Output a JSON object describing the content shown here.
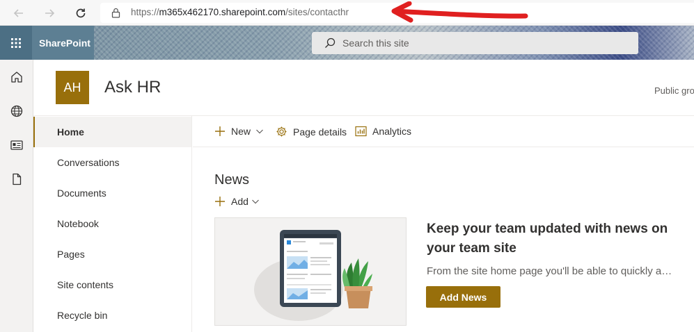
{
  "browser": {
    "url_prefix": "https://",
    "url_host": "m365x462170.sharepoint.com",
    "url_path": "/sites/contacthr"
  },
  "suite": {
    "app_name": "SharePoint",
    "search_placeholder": "Search this site"
  },
  "site": {
    "logo_initials": "AH",
    "title": "Ask HR",
    "meta": "Public gro"
  },
  "leftnav": {
    "items": [
      {
        "label": "Home"
      },
      {
        "label": "Conversations"
      },
      {
        "label": "Documents"
      },
      {
        "label": "Notebook"
      },
      {
        "label": "Pages"
      },
      {
        "label": "Site contents"
      },
      {
        "label": "Recycle bin"
      }
    ]
  },
  "commandbar": {
    "new_label": "New",
    "page_details_label": "Page details",
    "analytics_label": "Analytics"
  },
  "news": {
    "title": "News",
    "add_label": "Add",
    "heading": "Keep your team updated with news on your team site",
    "description": "From the site home page you'll be able to quickly author news posts",
    "button_label": "Add News"
  },
  "colors": {
    "accent": "#986f0b",
    "annotation_arrow": "#e02020",
    "suitebar": "#5a7f94"
  }
}
